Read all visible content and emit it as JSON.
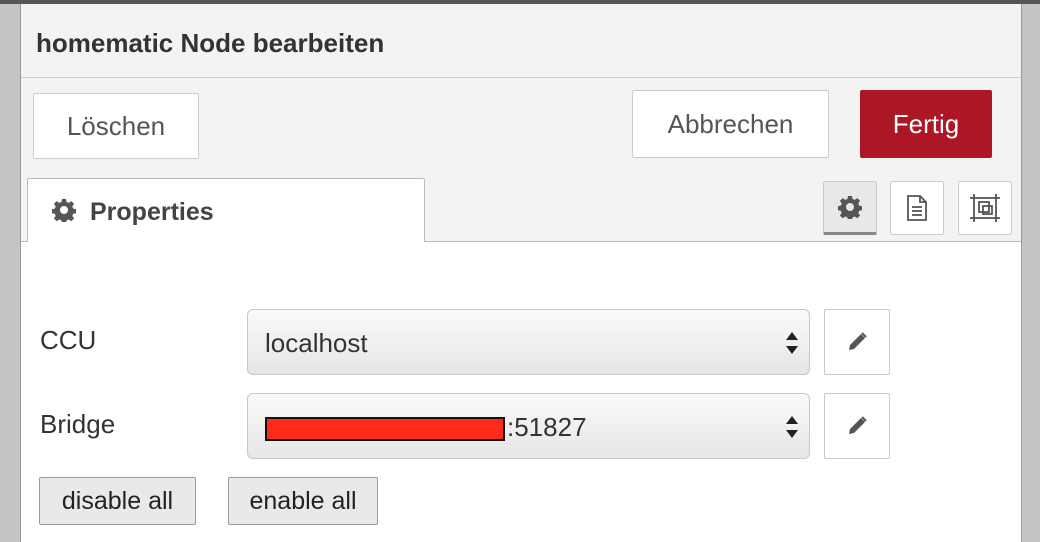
{
  "dialog": {
    "title": "homematic Node bearbeiten",
    "delete_label": "Löschen",
    "cancel_label": "Abbrechen",
    "done_label": "Fertig",
    "accent_color": "#ad1625"
  },
  "tabs": {
    "active_label": "Properties",
    "active_icon": "gear-icon",
    "tool_icons": [
      "gear-icon",
      "document-icon",
      "frame-icon"
    ]
  },
  "form": {
    "ccu": {
      "label": "CCU",
      "value": "localhost"
    },
    "bridge": {
      "label": "Bridge",
      "value_suffix": ":51827",
      "redacted_color": "#ff2a1a"
    }
  },
  "actions": {
    "disable_all": "disable all",
    "enable_all": "enable all"
  }
}
